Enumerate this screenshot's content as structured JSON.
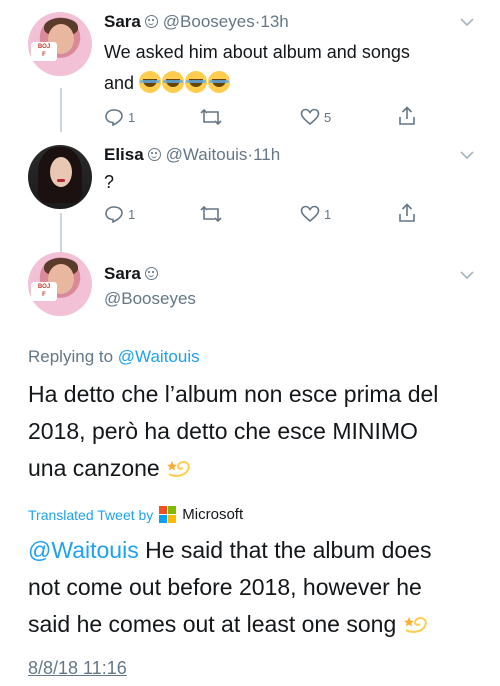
{
  "tweets": [
    {
      "name": "Sara",
      "handle": "@Booseyes",
      "time": "13h",
      "text_line1": "We asked him about album and songs",
      "text_line2": "and",
      "emoji_count": 4,
      "emoji_name": "crying-laughing-emoji",
      "replies": "1",
      "retweets": "",
      "likes": "5"
    },
    {
      "name": "Elisa",
      "handle": "@Waitouis",
      "time": "11h",
      "text_line1": "?",
      "replies": "1",
      "retweets": "",
      "likes": "1"
    }
  ],
  "main": {
    "name": "Sara",
    "handle": "@Booseyes",
    "replying_prefix": "Replying to",
    "replying_to": "@Waitouis",
    "text_line1": "Ha detto che l’album non esce prima del",
    "text_line2": "2018, però ha detto che esce MINIMO",
    "text_line3": "una canzone",
    "translated_label": "Translated Tweet by",
    "translator": "Microsoft",
    "translation_mention": "@Waitouis",
    "translation_line1": " He said that the album does",
    "translation_line2": "not come out before 2018, however he",
    "translation_line3": "said he comes out at least one song",
    "timestamp": "8/8/18 11:16"
  },
  "separator": "·",
  "colors": {
    "link_blue": "#1da1f2",
    "secondary_gray": "#657786",
    "text_dark": "#14171a",
    "thread_line": "#ccd6dd",
    "ms_red": "#f25022",
    "ms_green": "#7fba00",
    "ms_blue": "#00a4ef",
    "ms_yellow": "#ffb900"
  }
}
